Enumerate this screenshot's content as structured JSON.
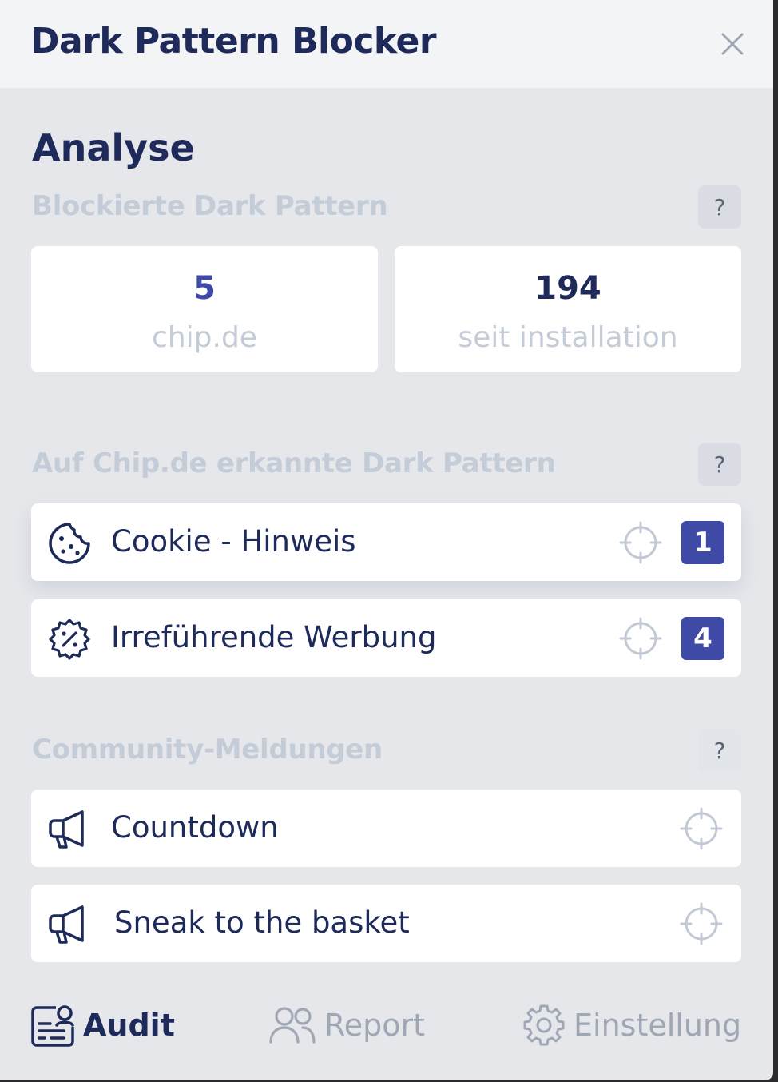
{
  "header": {
    "title": "Dark Pattern Blocker",
    "close_icon": "close-icon"
  },
  "analysis": {
    "title": "Analyse",
    "blocked": {
      "heading": "Blockierte Dark Pattern",
      "help": "?",
      "site": {
        "value": "5",
        "label": "chip.de"
      },
      "total": {
        "value": "194",
        "label": "seit installation"
      }
    },
    "detected": {
      "heading": "Auf Chip.de erkannte Dark Pattern",
      "help": "?",
      "items": [
        {
          "label": "Cookie - Hinweis",
          "count": "1",
          "icon": "cookie-icon"
        },
        {
          "label": "Irreführende Werbung",
          "count": "4",
          "icon": "discount-badge-icon"
        }
      ]
    },
    "community": {
      "heading": "Community-Meldungen",
      "help": "?",
      "items": [
        {
          "label": "Countdown",
          "icon": "megaphone-icon"
        },
        {
          "label": "Sneak to the basket",
          "icon": "megaphone-icon"
        }
      ]
    }
  },
  "nav": {
    "items": [
      {
        "label": "Audit",
        "icon": "audit-icon",
        "active": true
      },
      {
        "label": "Report",
        "icon": "users-icon",
        "active": false
      },
      {
        "label": "Einstellung",
        "icon": "gear-icon",
        "active": false
      }
    ]
  },
  "colors": {
    "primary": "#1e2a5a",
    "accent": "#3f4aa6",
    "muted": "#c4ccd8",
    "icon_muted": "#c3c9d4"
  }
}
